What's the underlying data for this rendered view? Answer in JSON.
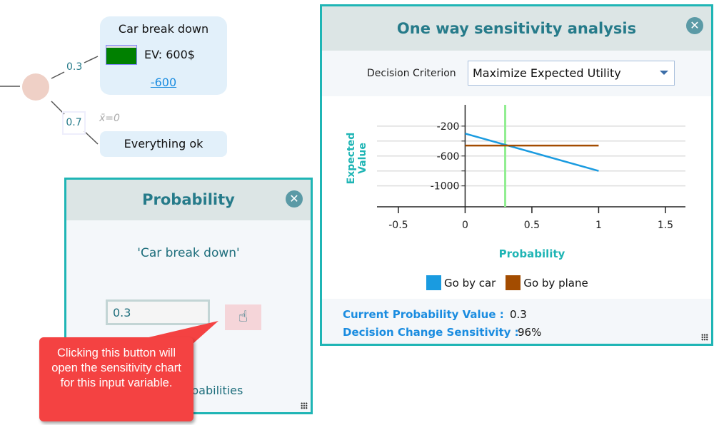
{
  "tree": {
    "prob_top": "0.3",
    "prob_bottom": "0.7",
    "mean_label": "x̄=0",
    "node_top": {
      "title": "Car break down",
      "ev": "EV: 600$",
      "value": "-600"
    },
    "node_bottom": {
      "title": "Everything ok"
    }
  },
  "sensitivity": {
    "title": "One way sensitivity analysis",
    "criterion_label": "Decision Criterion",
    "criterion_value": "Maximize Expected Utility",
    "current_label": "Current Probability Value :",
    "current_value": "0.3",
    "change_label": "Decision Change Sensitivity :",
    "change_value": "96%"
  },
  "probability": {
    "title": "Probability",
    "variable": "'Car break down'",
    "input_value": "0.3",
    "partial_text": "babilities"
  },
  "callout": {
    "text": "Clicking this button will open the sensitivity chart for this input variable."
  },
  "colors": {
    "accent": "#1fb5b5",
    "callout": "#f44242",
    "go_by_car": "#1a9be0",
    "go_by_plane": "#a34c00",
    "current_marker": "#90ee90"
  },
  "chart_data": {
    "type": "line",
    "xlabel": "Probability",
    "ylabel": "Expected Value",
    "xlim": [
      -0.66,
      1.65
    ],
    "ylim": [
      -1280,
      85
    ],
    "xticks": [
      -0.5,
      0,
      0.5,
      1,
      1.5
    ],
    "xtick_labels": [
      "-0.5",
      "0",
      "0.5",
      "1",
      "1.5"
    ],
    "yticks": [
      -200,
      -600,
      -1000
    ],
    "ytick_labels": [
      "-200",
      "-600",
      "-1000"
    ],
    "grid_y": [
      -200,
      -400,
      -600,
      -800,
      -1000
    ],
    "grid": true,
    "legend": "bottom",
    "current_x": 0.3,
    "series": [
      {
        "name": "Go by car",
        "x": [
          0,
          1
        ],
        "y": [
          -300,
          -800
        ]
      },
      {
        "name": "Go by plane",
        "x": [
          0,
          1
        ],
        "y": [
          -460,
          -460
        ]
      }
    ]
  }
}
